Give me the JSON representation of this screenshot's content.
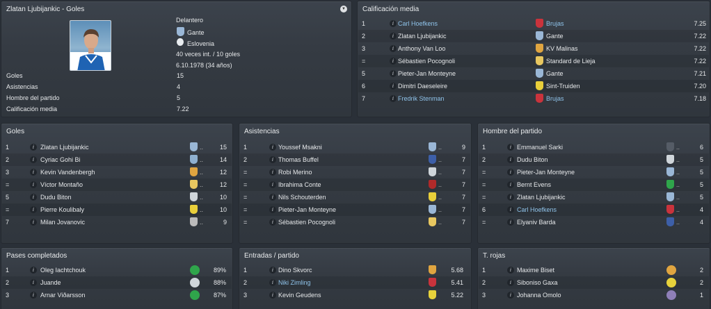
{
  "profile": {
    "title": "Zlatan Ljubijankic - Goles",
    "position": "Delantero",
    "club": "Gante",
    "nation": "Eslovenia",
    "caps": "40 veces int. / 10 goles",
    "dob": "6.10.1978 (34 años)",
    "stats": [
      {
        "label": "Goles",
        "value": "15"
      },
      {
        "label": "Asistencias",
        "value": "4"
      },
      {
        "label": "Hombre del partido",
        "value": "5"
      },
      {
        "label": "Calificación media",
        "value": "7.22"
      }
    ]
  },
  "rating": {
    "title": "Calificación media",
    "rows": [
      {
        "rank": "1",
        "name": "Carl Hoefkens",
        "club": "Brujas",
        "value": "7.25",
        "link": true,
        "crest": "brujas"
      },
      {
        "rank": "2",
        "name": "Zlatan Ljubijankic",
        "club": "Gante",
        "value": "7.22",
        "link": false,
        "crest": "gante"
      },
      {
        "rank": "3",
        "name": "Anthony Van Loo",
        "club": "KV Malinas",
        "value": "7.22",
        "link": false,
        "crest": "malinas"
      },
      {
        "rank": "=",
        "name": "Sébastien Pocognoli",
        "club": "Standard de Lieja",
        "value": "7.22",
        "link": false,
        "crest": "standard"
      },
      {
        "rank": "5",
        "name": "Pieter-Jan Monteyne",
        "club": "Gante",
        "value": "7.21",
        "link": false,
        "crest": "gante"
      },
      {
        "rank": "6",
        "name": "Dimitri Daeseleire",
        "club": "Sint-Truiden",
        "value": "7.20",
        "link": false,
        "crest": "truiden"
      },
      {
        "rank": "7",
        "name": "Fredrik Stenman",
        "club": "Brujas",
        "value": "7.18",
        "link": true,
        "crest": "brujas"
      }
    ]
  },
  "goles": {
    "title": "Goles",
    "rows": [
      {
        "rank": "1",
        "name": "Zlatan Ljubijankic",
        "value": "15",
        "crest": "gante"
      },
      {
        "rank": "2",
        "name": "Cyriac Gohi Bi",
        "value": "14",
        "crest": "zulte"
      },
      {
        "rank": "3",
        "name": "Kevin Vandenbergh",
        "value": "12",
        "crest": "malinas"
      },
      {
        "rank": "=",
        "name": "Víctor Montaño",
        "value": "12",
        "crest": "standard"
      },
      {
        "rank": "5",
        "name": "Dudu Biton",
        "value": "10",
        "crest": "charleroi"
      },
      {
        "rank": "=",
        "name": "Pierre Koulibaly",
        "value": "10",
        "crest": "truiden"
      },
      {
        "rank": "7",
        "name": "Milan Jovanovic",
        "value": "9",
        "crest": "anderlecht"
      }
    ]
  },
  "asistencias": {
    "title": "Asistencias",
    "rows": [
      {
        "rank": "1",
        "name": "Youssef Msakni",
        "value": "9",
        "crest": "gante"
      },
      {
        "rank": "2",
        "name": "Thomas Buffel",
        "value": "7",
        "crest": "genk"
      },
      {
        "rank": "=",
        "name": "Robi Merino",
        "value": "7",
        "crest": "charleroi"
      },
      {
        "rank": "=",
        "name": "Ibrahima Conte",
        "value": "7",
        "crest": "kortrijk"
      },
      {
        "rank": "=",
        "name": "Nils Schouterden",
        "value": "7",
        "crest": "truiden"
      },
      {
        "rank": "=",
        "name": "Pieter-Jan Monteyne",
        "value": "7",
        "crest": "gante"
      },
      {
        "rank": "=",
        "name": "Sébastien Pocognoli",
        "value": "7",
        "crest": "standard"
      }
    ]
  },
  "hombre": {
    "title": "Hombre del partido",
    "rows": [
      {
        "rank": "1",
        "name": "Emmanuel Sarki",
        "value": "6",
        "crest": "waasland",
        "link": false
      },
      {
        "rank": "2",
        "name": "Dudu Biton",
        "value": "5",
        "crest": "charleroi",
        "link": false
      },
      {
        "rank": "=",
        "name": "Pieter-Jan Monteyne",
        "value": "5",
        "crest": "gante",
        "link": false
      },
      {
        "rank": "=",
        "name": "Bernt Evens",
        "value": "5",
        "crest": "cercle",
        "link": false
      },
      {
        "rank": "=",
        "name": "Zlatan Ljubijankic",
        "value": "5",
        "crest": "gante",
        "link": false
      },
      {
        "rank": "6",
        "name": "Carl Hoefkens",
        "value": "4",
        "crest": "brujas",
        "link": true
      },
      {
        "rank": "=",
        "name": "Elyaniv Barda",
        "value": "4",
        "crest": "genk",
        "link": false
      }
    ]
  },
  "pases": {
    "title": "Pases completados",
    "rows": [
      {
        "rank": "1",
        "name": "Oleg Iachtchouk",
        "value": "89%",
        "crest": "cercle"
      },
      {
        "rank": "2",
        "name": "Juande",
        "value": "88%",
        "crest": "charleroi"
      },
      {
        "rank": "3",
        "name": "Arnar Viðarsson",
        "value": "87%",
        "crest": "cercle"
      }
    ]
  },
  "entradas": {
    "title": "Entradas / partido",
    "rows": [
      {
        "rank": "1",
        "name": "Dino Skvorc",
        "value": "5.68",
        "crest": "malinas",
        "link": false
      },
      {
        "rank": "2",
        "name": "Niki Zimling",
        "value": "5.41",
        "crest": "brujas",
        "link": true
      },
      {
        "rank": "3",
        "name": "Kevin Geudens",
        "value": "5.22",
        "crest": "lierse",
        "link": false
      }
    ]
  },
  "rojas": {
    "title": "T. rojas",
    "rows": [
      {
        "rank": "1",
        "name": "Maxime Biset",
        "value": "2",
        "crest": "malinas"
      },
      {
        "rank": "2",
        "name": "Siboniso Gaxa",
        "value": "2",
        "crest": "lierse"
      },
      {
        "rank": "3",
        "name": "Johanna Omolo",
        "value": "1",
        "crest": "beerschot"
      }
    ]
  },
  "crest_colors": {
    "gante": "#9ab7d6",
    "brujas": "#c9333c",
    "malinas": "#e0a540",
    "standard": "#e8c760",
    "truiden": "#e9cf3a",
    "zulte": "#8fb0d0",
    "charleroi": "#cfd5da",
    "anderlecht": "#bbbbbb",
    "genk": "#3d5fa8",
    "kortrijk": "#b02a2a",
    "waasland": "#555c66",
    "cercle": "#2fa54b",
    "lierse": "#e7d23b",
    "beerschot": "#8f7fb8"
  },
  "truncation": ".."
}
